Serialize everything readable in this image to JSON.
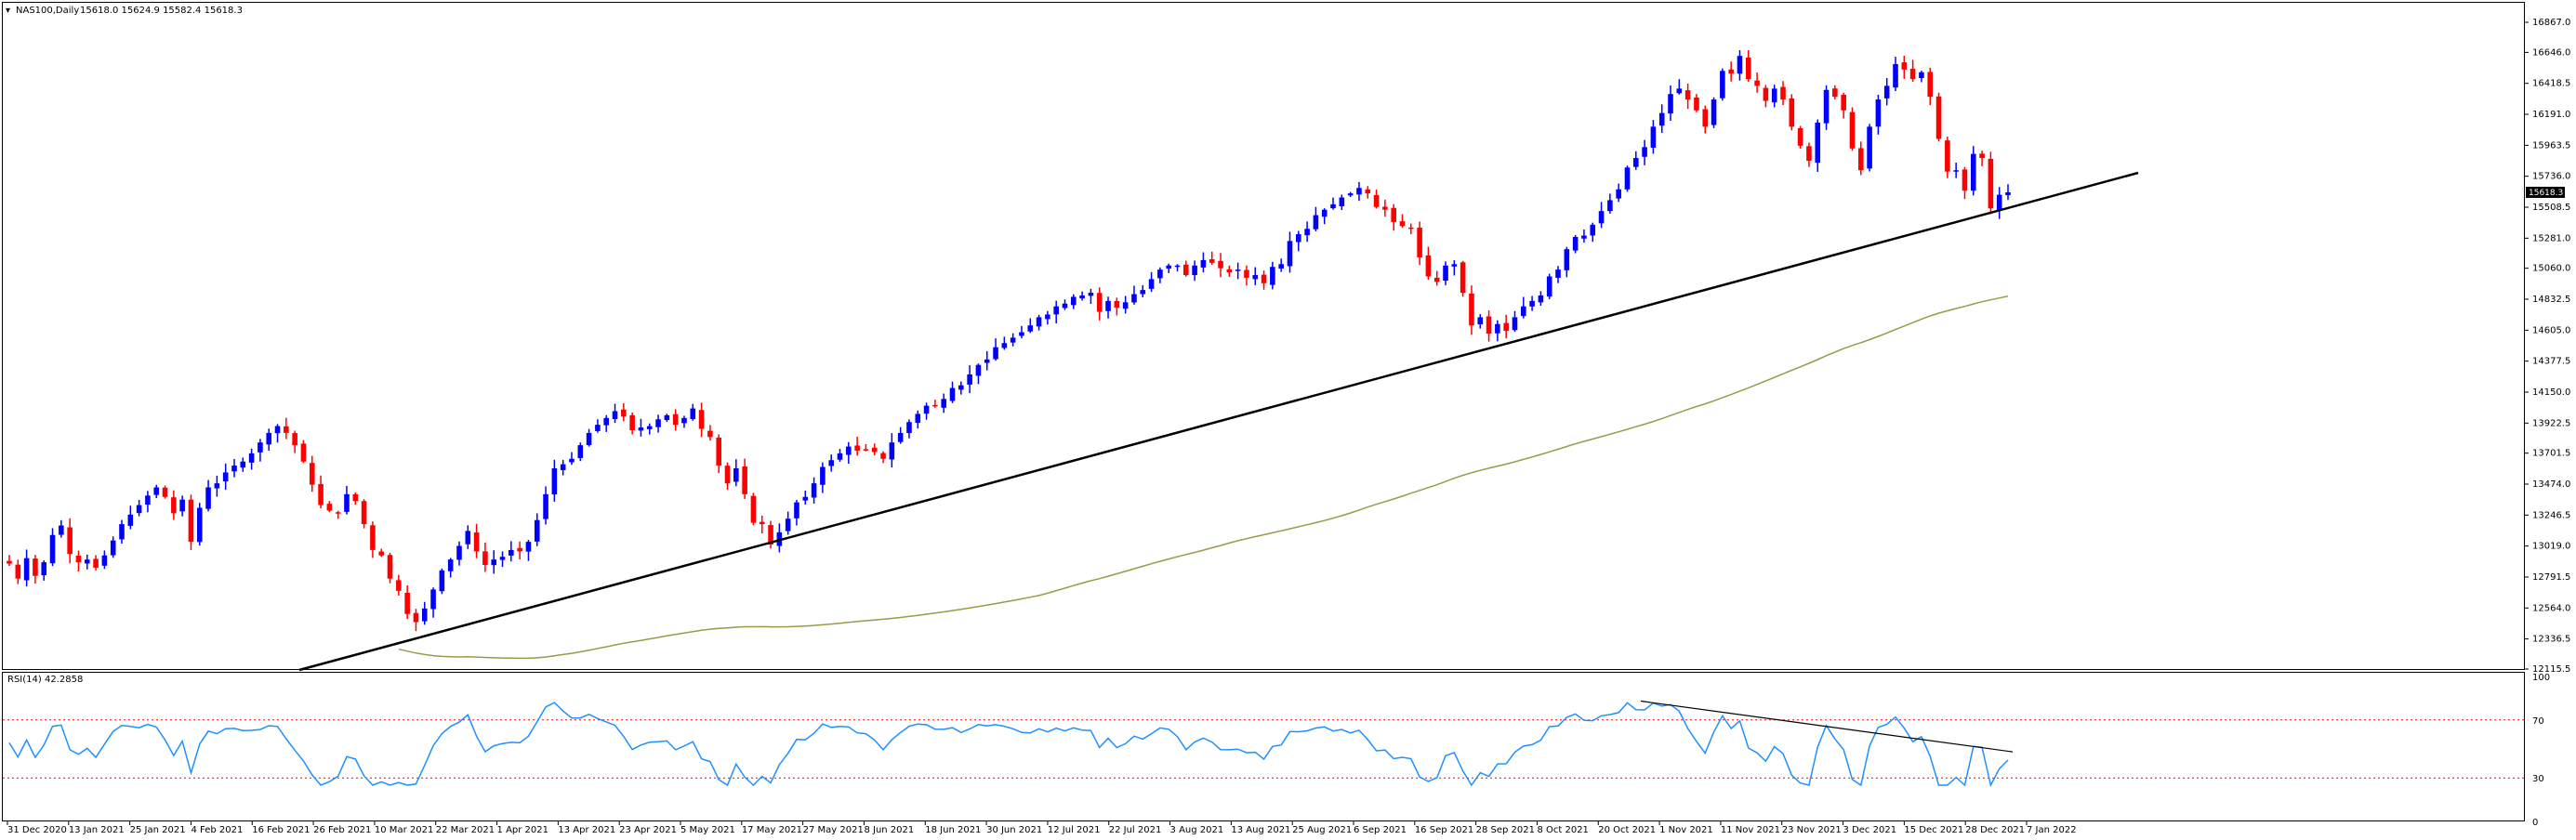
{
  "header": {
    "symbol_label": "NAS100,Daily",
    "ohlc_text": "15618.0 15624.9 15582.4 15618.3"
  },
  "rsi_header": "RSI(14) 42.2858",
  "current_price": "15618.3",
  "colors": {
    "bull": "#0000ff",
    "bear": "#ff0000",
    "ma": "#9a9a4a",
    "rsi": "#1e90ff",
    "rsi_levels": "#ff0000",
    "trendline": "#000000",
    "current_price_bg": "#000000"
  },
  "chart_data": [
    {
      "type": "candlestick",
      "symbol": "NAS100",
      "timeframe": "Daily",
      "ylim": [
        12115.5,
        16867.0
      ],
      "y_ticks": [
        "16867.0",
        "16646.0",
        "16418.5",
        "16191.0",
        "15963.5",
        "15736.0",
        "15508.5",
        "15281.0",
        "15060.0",
        "14832.5",
        "14605.0",
        "14377.5",
        "14150.0",
        "13922.5",
        "13701.5",
        "13474.0",
        "13246.5",
        "13019.0",
        "12791.5",
        "12564.0",
        "12336.5",
        "12115.5"
      ],
      "x_tick_labels": [
        "31 Dec 2020",
        "13 Jan 2021",
        "25 Jan 2021",
        "4 Feb 2021",
        "16 Feb 2021",
        "26 Feb 2021",
        "10 Mar 2021",
        "22 Mar 2021",
        "1 Apr 2021",
        "13 Apr 2021",
        "23 Apr 2021",
        "5 May 2021",
        "17 May 2021",
        "27 May 2021",
        "8 Jun 2021",
        "18 Jun 2021",
        "30 Jun 2021",
        "12 Jul 2021",
        "22 Jul 2021",
        "3 Aug 2021",
        "13 Aug 2021",
        "25 Aug 2021",
        "6 Sep 2021",
        "16 Sep 2021",
        "28 Sep 2021",
        "8 Oct 2021",
        "20 Oct 2021",
        "1 Nov 2021",
        "11 Nov 2021",
        "23 Nov 2021",
        "3 Dec 2021",
        "15 Dec 2021",
        "28 Dec 2021",
        "7 Jan 2022"
      ],
      "close_series": [
        12890,
        12780,
        12930,
        12800,
        12900,
        13100,
        13170,
        12960,
        12900,
        12920,
        12860,
        12950,
        13060,
        13180,
        13250,
        13320,
        13390,
        13450,
        13380,
        13260,
        13360,
        13050,
        13300,
        13450,
        13480,
        13560,
        13610,
        13640,
        13700,
        13780,
        13850,
        13900,
        13850,
        13760,
        13640,
        13470,
        13320,
        13280,
        13260,
        13400,
        13350,
        13180,
        12990,
        12950,
        12780,
        12690,
        12520,
        12460,
        12560,
        12700,
        12840,
        12920,
        13020,
        13130,
        12980,
        12880,
        12920,
        12940,
        12990,
        12980,
        13050,
        13210,
        13400,
        13590,
        13620,
        13660,
        13760,
        13850,
        13910,
        13960,
        14010,
        13970,
        13870,
        13890,
        13900,
        13950,
        13980,
        13910,
        13960,
        14030,
        13880,
        13820,
        13610,
        13480,
        13590,
        13400,
        13190,
        13180,
        13030,
        13120,
        13220,
        13340,
        13380,
        13480,
        13600,
        13650,
        13700,
        13750,
        13720,
        13730,
        13710,
        13660,
        13780,
        13850,
        13930,
        13990,
        14050,
        14050,
        14100,
        14180,
        14200,
        14280,
        14350,
        14390,
        14480,
        14510,
        14550,
        14590,
        14640,
        14700,
        14720,
        14780,
        14800,
        14850,
        14860,
        14880,
        14740,
        14820,
        14770,
        14810,
        14870,
        14900,
        14980,
        15050,
        15080,
        15080,
        15010,
        15080,
        15120,
        15100,
        15060,
        15030,
        15050,
        14990,
        15010,
        14950,
        15070,
        15090,
        15260,
        15310,
        15350,
        15450,
        15490,
        15530,
        15580,
        15610,
        15650,
        15610,
        15510,
        15490,
        15400,
        15370,
        15350,
        15140,
        15000,
        14960,
        15080,
        15090,
        14880,
        14640,
        14700,
        14580,
        14650,
        14600,
        14700,
        14780,
        14820,
        14860,
        15000,
        15050,
        15200,
        15290,
        15300,
        15380,
        15480,
        15560,
        15640,
        15800,
        15870,
        15950,
        16100,
        16200,
        16340,
        16380,
        16300,
        16220,
        16100,
        16300,
        16510,
        16490,
        16620,
        16450,
        16400,
        16290,
        16380,
        16300,
        16100,
        15960,
        15850,
        16130,
        16370,
        16320,
        16220,
        15940,
        15780,
        16100,
        16300,
        16400,
        16560,
        16520,
        16450,
        16500,
        16320,
        16010,
        15770,
        15780,
        15630,
        15900,
        15870,
        15500,
        15600,
        15618
      ]
    },
    {
      "type": "line",
      "name": "RSI(14)",
      "ylim": [
        0,
        100
      ],
      "y_ticks": [
        "100",
        "70",
        "30",
        "0"
      ],
      "levels": [
        30,
        70
      ],
      "current_value": 42.2858
    }
  ]
}
